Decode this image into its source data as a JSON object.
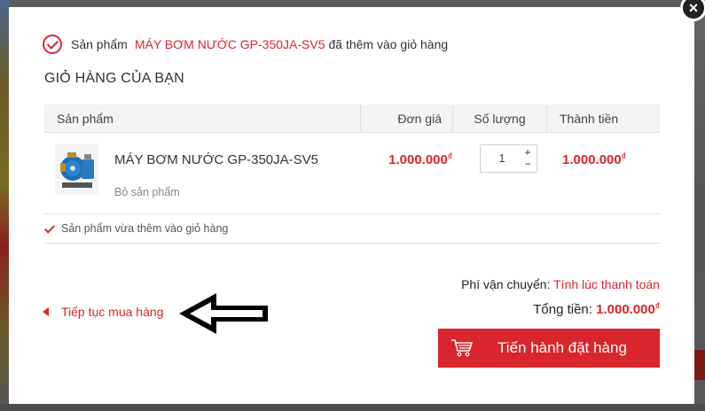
{
  "close_symbol": "×",
  "notice": {
    "prefix": "Sản phẩm",
    "product_name": "MÁY BƠM NƯỚC GP-350JA-SV5",
    "suffix": "đã thêm vào giỏ hàng"
  },
  "cart_title": "GIỎ HÀNG CỦA BẠN",
  "table": {
    "headers": {
      "product": "Sản phẩm",
      "unit_price": "Đơn giá",
      "quantity": "Số lượng",
      "total": "Thành tiền"
    },
    "items": [
      {
        "name": "MÁY BƠM NƯỚC GP-350JA-SV5",
        "remove_label": "Bỏ sản phẩm",
        "price": "1.000.000",
        "qty": "1",
        "total": "1.000.000",
        "thumb_icon": "water-pump-image"
      }
    ],
    "currency_symbol": "₫",
    "qty_plus": "+",
    "qty_minus": "−"
  },
  "added_note": "Sản phẩm vừa thêm vào giỏ hàng",
  "continue_label": "Tiếp tục mua hàng",
  "shipping": {
    "label": "Phí vận chuyển:",
    "value": "Tính lúc thanh toán"
  },
  "grand_total": {
    "label": "Tổng tiền:",
    "value": "1.000.000"
  },
  "checkout_label": "Tiến hành đặt hàng",
  "colors": {
    "accent": "#d9262c",
    "overlay": "#5a5a5a"
  }
}
